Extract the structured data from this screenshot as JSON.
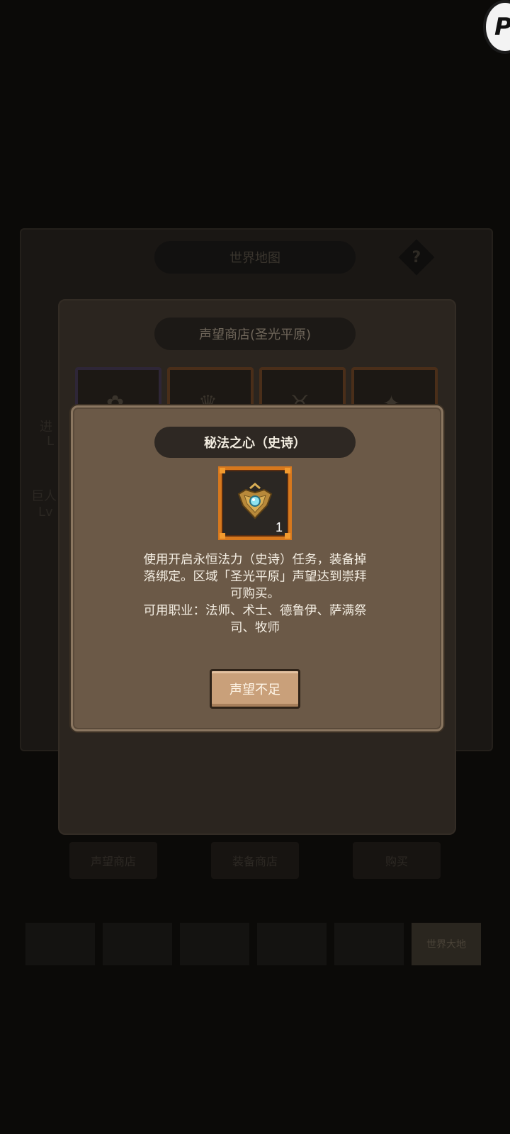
{
  "background": {
    "window_title": "世界地图",
    "help_symbol": "?",
    "side_left_1": "进",
    "side_left_2": "L",
    "side_left_3": "巨人",
    "side_left_4": "Lv",
    "bottom_buttons": [
      "声望商店",
      "装备商店",
      "购买"
    ],
    "tabs": [
      "",
      "",
      "",
      "",
      "",
      "世界大地"
    ]
  },
  "shop": {
    "title": "声望商店(圣光平原)"
  },
  "modal": {
    "title": "秘法之心（史诗）",
    "item_count": "1",
    "description_lines": [
      "使用开启永恒法力（史诗）任务，装备掉",
      "落绑定。区域「圣光平原」声望达到崇拜",
      "可购买。",
      "可用职业：法师、术士、德鲁伊、萨满祭",
      "司、牧师"
    ],
    "button_label": "声望不足"
  },
  "corner_logo_letter": "P",
  "colors": {
    "modal_bg": "#6b5947",
    "title_pill": "#2e2823",
    "item_frame": "#d7781d",
    "button": "#c9a07a"
  }
}
